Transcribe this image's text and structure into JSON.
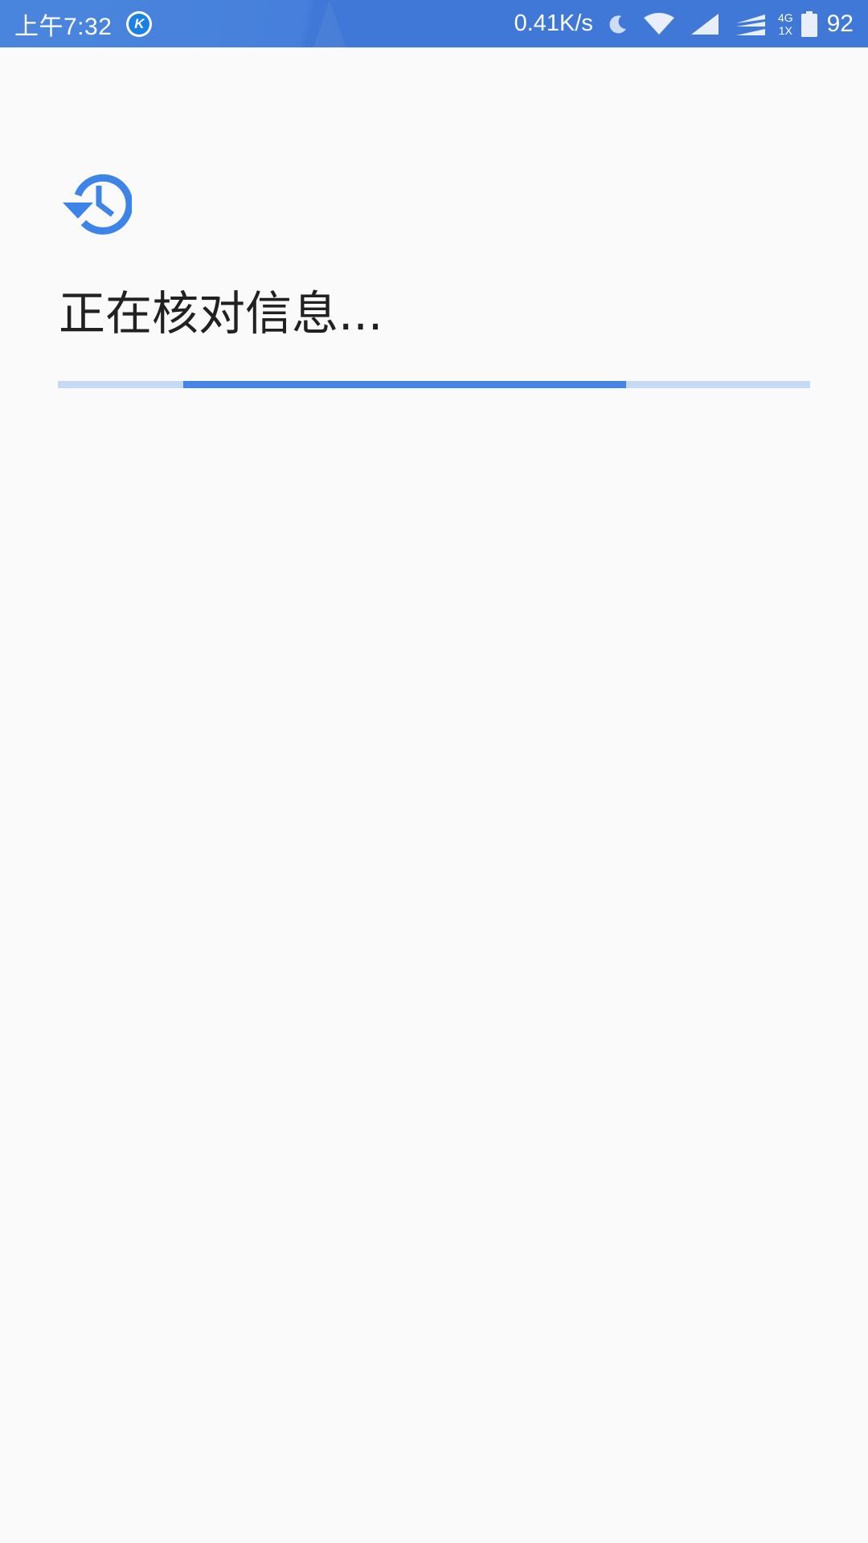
{
  "status_bar": {
    "time": "上午7:32",
    "app_icon": "k-icon",
    "app_icon_letter": "K",
    "net_speed": "0.41K/s",
    "icons": [
      "moon-icon",
      "wifi-icon",
      "signal-icon",
      "signal-icon-2"
    ],
    "net_type_top": "4G",
    "net_type_bottom": "1X",
    "battery_level": "92"
  },
  "main": {
    "icon": "history-icon",
    "title": "正在核对信息...",
    "progress": {
      "indeterminate": true,
      "indicator_start": 0.167,
      "indicator_end": 0.755
    }
  },
  "colors": {
    "status_bar": "#4680dc",
    "accent": "#4485e6",
    "track": "#c7daf5",
    "background": "#fafafa",
    "text": "#212121"
  }
}
